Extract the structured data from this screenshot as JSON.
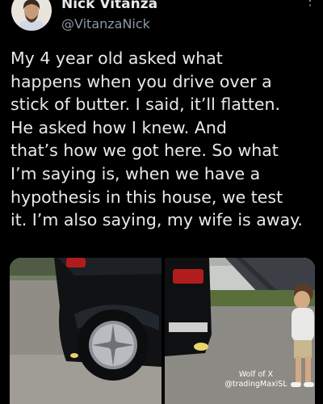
{
  "author": {
    "display_name": "Nick Vitanza",
    "handle": "@VitanzaNick",
    "avatar": "avatar-photo"
  },
  "tweet": {
    "lines": [
      "My 4 year old asked what",
      "happens when you drive over a",
      "stick of butter. I said, it’ll flatten.",
      "He asked how I knew. And",
      "that’s how we got here. So what",
      "I’m saying is, when we have a",
      "hypothesis in this house, we test",
      "it. I’m also saying, my wife is away."
    ]
  },
  "menu": {
    "icon": "more-vertical-icon",
    "glyph": "⋮"
  },
  "media": {
    "photos": [
      "car-wheel-butter-photo",
      "car-rear-child-photo"
    ],
    "watermark_lines": [
      "Wolf of X",
      "@tradingMaxiSL"
    ]
  },
  "colors": {
    "background": "#000000",
    "text_primary": "#e7e9ea",
    "text_secondary": "#8b98a5"
  }
}
